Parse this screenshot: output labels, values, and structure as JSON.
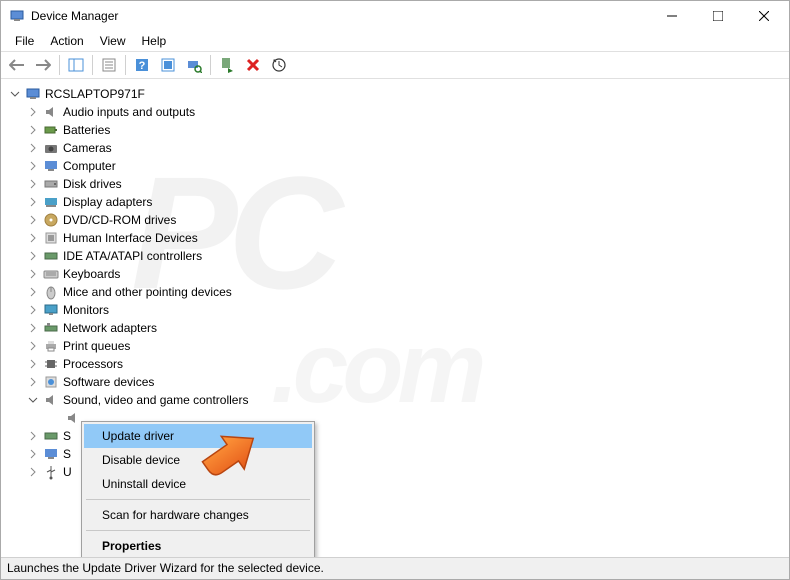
{
  "window": {
    "title": "Device Manager"
  },
  "menu": {
    "file": "File",
    "action": "Action",
    "view": "View",
    "help": "Help"
  },
  "tree": {
    "root": "RCSLAPTOP971F",
    "items": [
      "Audio inputs and outputs",
      "Batteries",
      "Cameras",
      "Computer",
      "Disk drives",
      "Display adapters",
      "DVD/CD-ROM drives",
      "Human Interface Devices",
      "IDE ATA/ATAPI controllers",
      "Keyboards",
      "Mice and other pointing devices",
      "Monitors",
      "Network adapters",
      "Print queues",
      "Processors",
      "Software devices",
      "Sound, video and game controllers"
    ],
    "trunc1": "S",
    "trunc2": "S",
    "trunc3": "U"
  },
  "context": {
    "update": "Update driver",
    "disable": "Disable device",
    "uninstall": "Uninstall device",
    "scan": "Scan for hardware changes",
    "props": "Properties"
  },
  "status": "Launches the Update Driver Wizard for the selected device."
}
